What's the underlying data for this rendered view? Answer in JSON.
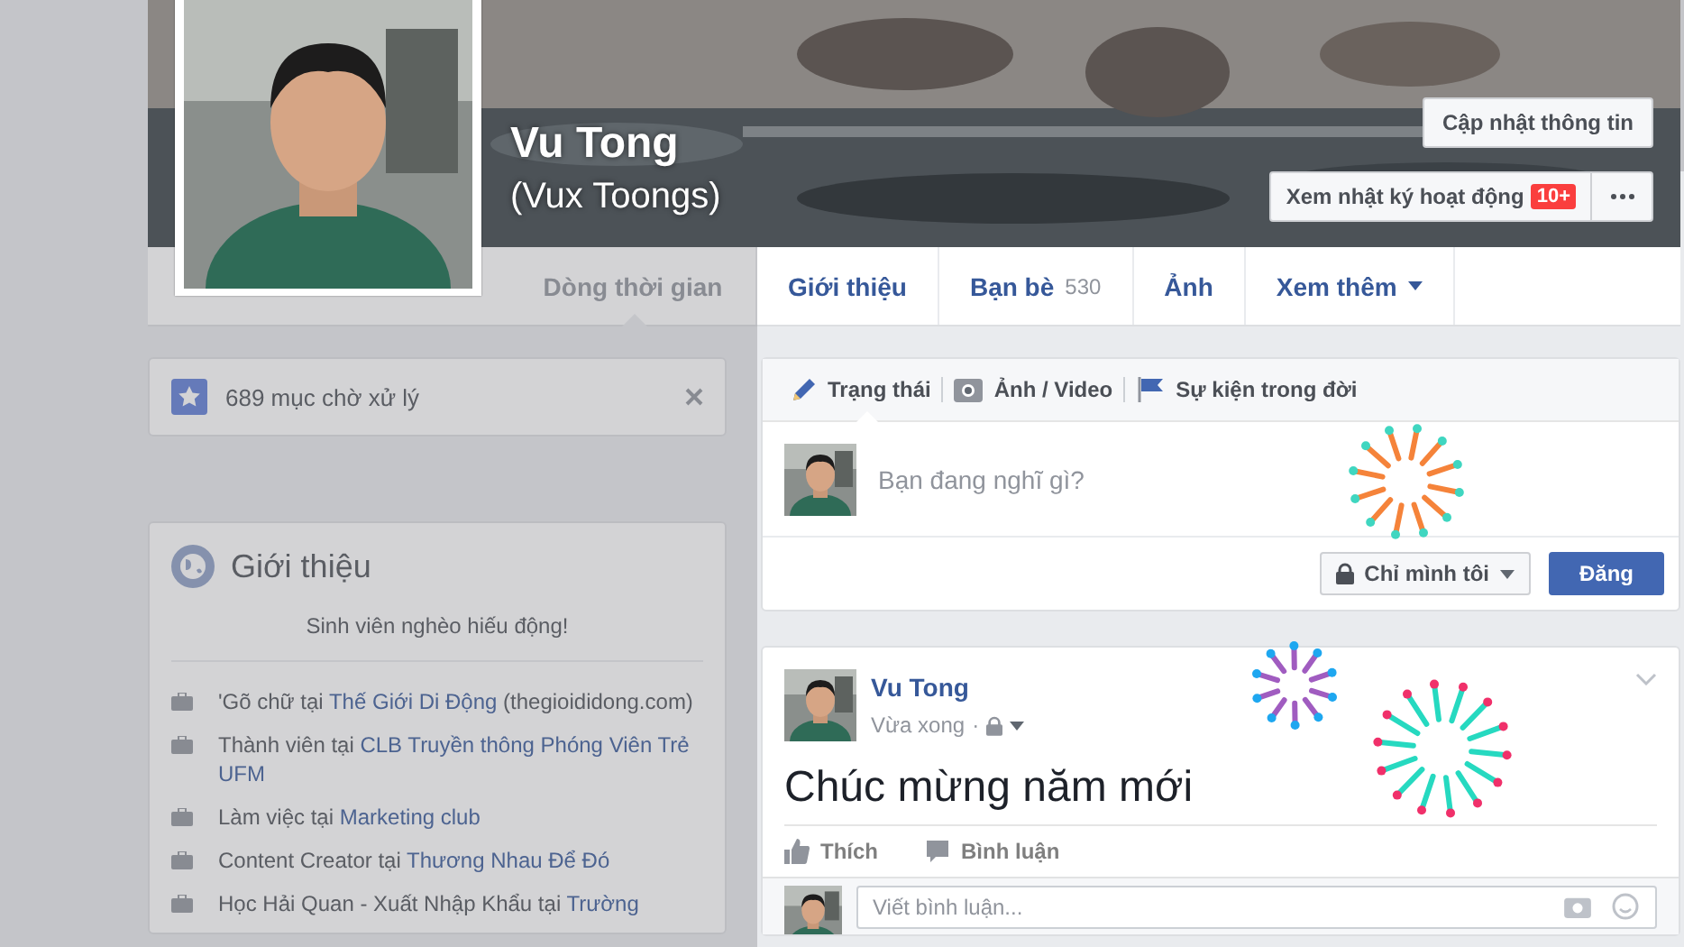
{
  "profile": {
    "name": "Vu Tong",
    "alt_name": "(Vux Toongs)",
    "update_button": "Cập nhật thông tin",
    "activity_button": "Xem nhật ký hoạt động",
    "activity_badge": "10+"
  },
  "nav_tabs": [
    {
      "label": "Dòng thời gian",
      "selected": true
    },
    {
      "label": "Giới thiệu",
      "selected": false
    },
    {
      "label": "Bạn bè",
      "count": "530",
      "selected": false
    },
    {
      "label": "Ảnh",
      "selected": false
    },
    {
      "label": "Xem thêm",
      "dropdown": true,
      "selected": false
    }
  ],
  "pending": {
    "text": "689 mục chờ xử lý"
  },
  "intro": {
    "title": "Giới thiệu",
    "bio": "Sinh viên nghèo hiếu động!",
    "items": [
      {
        "prefix": "'Gõ chữ tại ",
        "link": "Thế Giới Di Động",
        "suffix": " (thegioididong.com)"
      },
      {
        "prefix": "Thành viên tại ",
        "link": "CLB Truyền thông Phóng Viên Trẻ UFM"
      },
      {
        "prefix": "Làm việc tại ",
        "link": "Marketing club"
      },
      {
        "prefix": "Content Creator tại ",
        "link": "Thương Nhau Để Đó"
      },
      {
        "prefix": "Học Hải Quan - Xuất Nhập Khẩu tại ",
        "link": "Trường"
      }
    ]
  },
  "composer": {
    "tabs": [
      {
        "kind": "status",
        "label": "Trạng thái",
        "selected": true
      },
      {
        "label": "Ảnh / Video",
        "selected": false
      },
      {
        "kind": "event",
        "label": "Sự kiện trong đời",
        "selected": false
      }
    ],
    "placeholder": "Bạn đang nghĩ gì?",
    "privacy": "Chỉ mình tôi",
    "post_button": "Đăng"
  },
  "post": {
    "author": "Vu Tong",
    "time": "Vừa xong",
    "separator": "·",
    "text": "Chúc mừng năm mới",
    "actions": [
      {
        "kind": "like",
        "label": "Thích"
      },
      {
        "kind": "comment",
        "label": "Bình luận"
      }
    ],
    "comment_placeholder": "Viết bình luận..."
  }
}
